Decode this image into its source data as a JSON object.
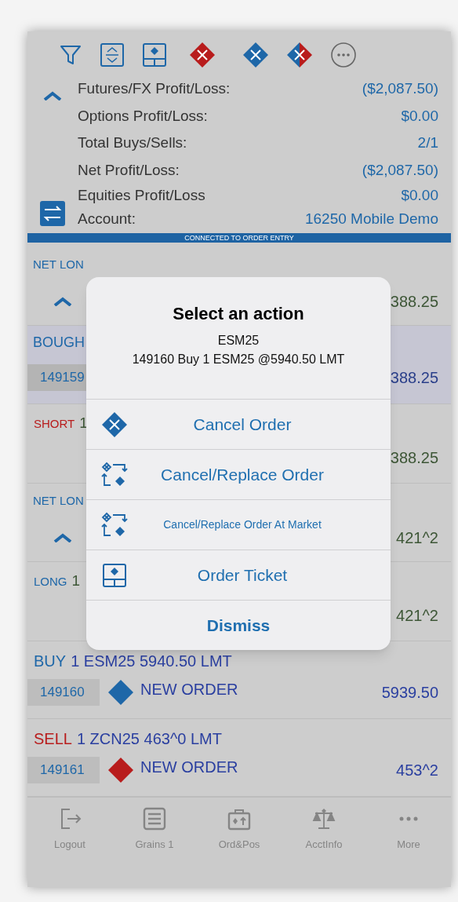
{
  "summary": {
    "stats": [
      {
        "label": "Futures/FX Profit/Loss:",
        "value": "($2,087.50)"
      },
      {
        "label": "Options Profit/Loss:",
        "value": "$0.00"
      },
      {
        "label": "Total Buys/Sells:",
        "value": "2/1"
      },
      {
        "label": "Net Profit/Loss:",
        "value": "($2,087.50)"
      },
      {
        "label": "Equities Profit/Loss",
        "value": "$0.00"
      },
      {
        "label": "Account:",
        "value": "16250 Mobile Demo"
      }
    ],
    "status_banner": "CONNECTED TO ORDER ENTRY"
  },
  "rows": [
    {
      "kind": "net",
      "label": "NET LON",
      "value": "388.25"
    },
    {
      "kind": "fill",
      "color": "#1e67a8",
      "label": "BOUGH",
      "order_id": "149159",
      "value": "388.25"
    },
    {
      "kind": "position",
      "color": "#b81c1c",
      "label": "SHORT",
      "qty": "1",
      "value": "388.25"
    },
    {
      "kind": "net",
      "label": "NET LON",
      "value": "421^2"
    },
    {
      "kind": "position",
      "color": "#1e67a8",
      "label": "LONG",
      "qty": "1",
      "value": "421^2"
    }
  ],
  "orders": [
    {
      "color": "#1e67a8",
      "action": "BUY",
      "detail": "1 ESM25 5940.50 LMT",
      "order_id": "149160",
      "status": "NEW ORDER",
      "price": "5939.50"
    },
    {
      "color": "#b81c1c",
      "action": "SELL",
      "detail": "1 ZCN25 463^0 LMT",
      "order_id": "149161",
      "status": "NEW ORDER",
      "price": "453^2"
    }
  ],
  "dialog": {
    "title": "Select an action",
    "subtitle": "ESM25",
    "message": "149160 Buy 1 ESM25 @5940.50 LMT",
    "actions": [
      {
        "kind": "cancel",
        "label": "Cancel Order"
      },
      {
        "kind": "replace",
        "label": "Cancel/Replace Order"
      },
      {
        "kind": "replace_small",
        "label": "Cancel/Replace Order At Market"
      },
      {
        "kind": "ticket",
        "label": "Order Ticket"
      },
      {
        "kind": "dismiss",
        "label": "Dismiss"
      }
    ]
  },
  "tab_bar": [
    {
      "kind": "logout",
      "label": "Logout",
      "selected": false
    },
    {
      "kind": "grid",
      "label": "Grains 1",
      "selected": false
    },
    {
      "kind": "case",
      "label": "Ord&Pos",
      "selected": false
    },
    {
      "kind": "scale",
      "label": "AcctInfo",
      "selected": false
    },
    {
      "kind": "more",
      "label": "More",
      "selected": false
    }
  ]
}
